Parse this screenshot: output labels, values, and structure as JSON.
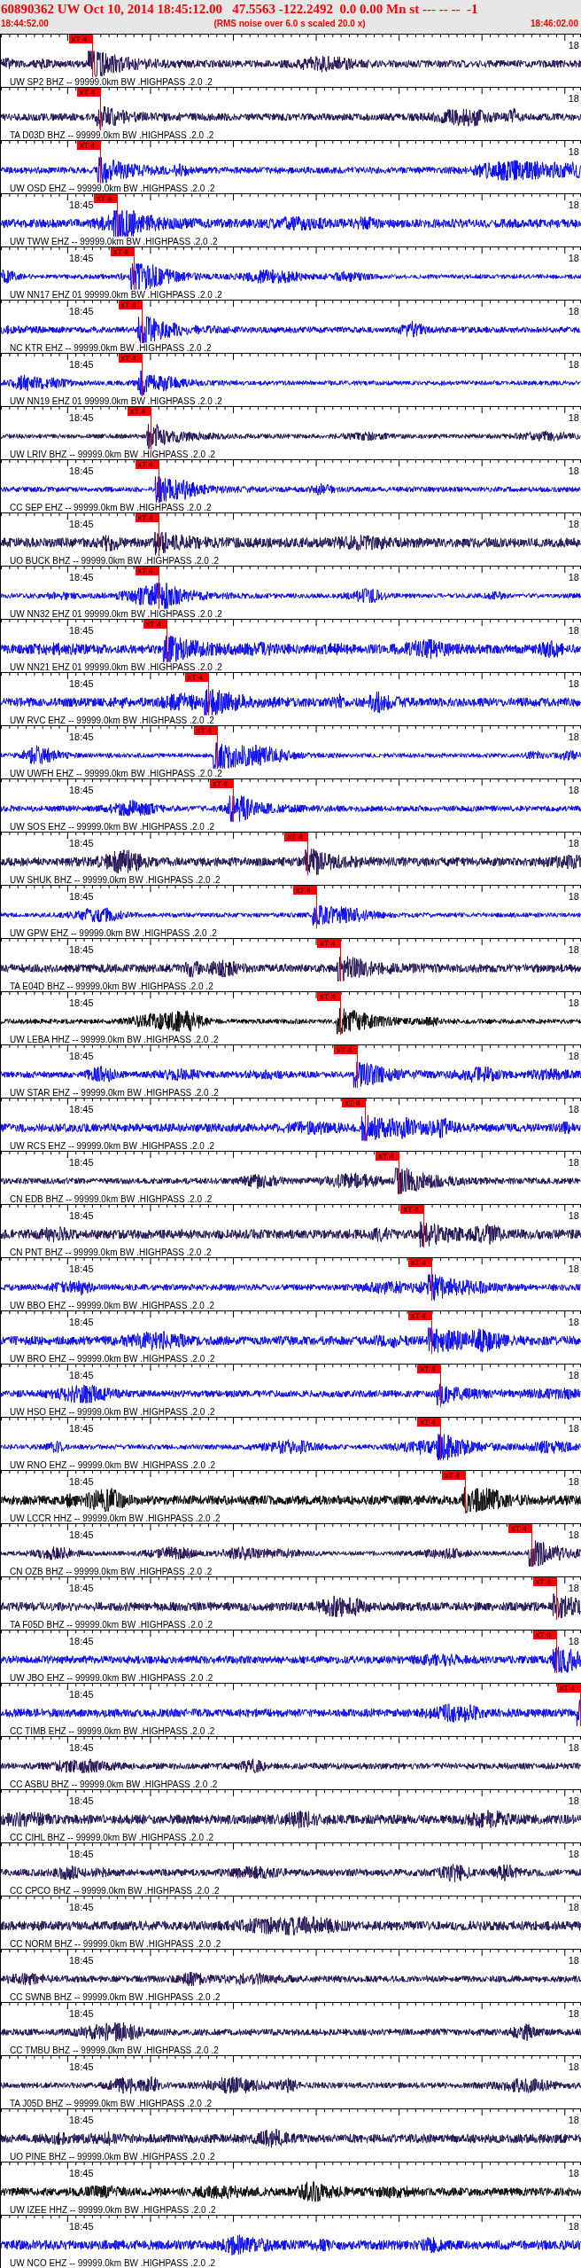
{
  "header": {
    "title": "60890362 UW Oct 10, 2014 18:45:12.00   47.5563 -122.2492  0.0 0.00 Mn st --- -- --  -1",
    "start_time": "18:44:52.00",
    "caption": "(RMS noise over 6.0 s scaled 20.0 x)",
    "end_time": "18:46:02.00"
  },
  "traces": [
    {
      "label": "UW SP2 BHZ -- 99999.0km BW .HIGHPASS .2.0 .2",
      "color": "#1e0a50",
      "end_label": "18",
      "pick": {
        "label": "xT 4",
        "level": 0.157
      }
    },
    {
      "label": "TA D03D BHZ -- 99999.0km BW .HIGHPASS .2.0 .2",
      "color": "#1e0a50",
      "end_label": "18",
      "pick": {
        "label": "xT 4",
        "level": 0.171
      }
    },
    {
      "label": "UW OSD EHZ -- 99999.0km BW .HIGHPASS .2.0 .2",
      "color": "#0000ff",
      "end_label": "18",
      "pick": {
        "label": "xT 4",
        "level": 0.171
      }
    },
    {
      "label": "UW TWW EHZ -- 99999.0km BW .HIGHPASS .2.0 .2",
      "color": "#0000ff",
      "time_label": "18:45",
      "end_label": "18",
      "pick": {
        "label": "xT 4",
        "level": 0.2
      }
    },
    {
      "label": "UW NN17 EHZ 01 99999.0km BW .HIGHPASS .2.0 .2",
      "color": "#0000ff",
      "time_label": "18:45",
      "end_label": "18",
      "pick": {
        "label": "xT 4",
        "level": 0.229
      }
    },
    {
      "label": "NC KTR EHZ -- 99999.0km BW .HIGHPASS .2.0 .2",
      "color": "#0000ff",
      "time_label": "18:45",
      "end_label": "18",
      "pick": {
        "label": "xT 4",
        "level": 0.242
      }
    },
    {
      "label": "UW NN19 EHZ 01 99999.0km BW .HIGHPASS .2.0 .2",
      "color": "#0000ff",
      "time_label": "18:45",
      "end_label": "18",
      "pick": {
        "label": "xT 4",
        "level": 0.242
      }
    },
    {
      "label": "UW LRIV BHZ -- 99999.0km BW .HIGHPASS .2.0 .2",
      "color": "#1e0a50",
      "time_label": "18:45",
      "end_label": "18",
      "pick": {
        "label": "xT 4",
        "level": 0.258
      }
    },
    {
      "label": "CC SEP EHZ -- 99999.0km BW .HIGHPASS .2.0 .2",
      "color": "#0000ff",
      "time_label": "18:45",
      "end_label": "18",
      "pick": {
        "label": "xT 4",
        "level": 0.271
      }
    },
    {
      "label": "UO BUCK BHZ -- 99999.0km BW .HIGHPASS .2.0 .2",
      "color": "#1e0a50",
      "time_label": "18:45",
      "end_label": "18",
      "pick": {
        "label": "xT 4",
        "level": 0.271
      }
    },
    {
      "label": "UW NN32 EHZ 01 99999.0km BW .HIGHPASS .2.0 .2",
      "color": "#0000ff",
      "time_label": "18:45",
      "end_label": "18",
      "pick": {
        "label": "xT 4",
        "level": 0.271
      }
    },
    {
      "label": "UW NN21 EHZ 01 99999.0km BW .HIGHPASS .2.0 .2",
      "color": "#0000ff",
      "time_label": "18:45",
      "end_label": "18",
      "pick": {
        "label": "xT 4",
        "level": 0.285
      }
    },
    {
      "label": "UW RVC EHZ -- 99999.0km BW .HIGHPASS .2.0 .2",
      "color": "#0000ff",
      "time_label": "18:45",
      "end_label": "18",
      "pick": {
        "label": "xT 4",
        "level": 0.357
      }
    },
    {
      "label": "UW UWFH EHZ -- 99999.0km BW .HIGHPASS .2.0 .2",
      "color": "#0000ff",
      "time_label": "18:45",
      "end_label": "18",
      "pick": {
        "label": "xT 4",
        "level": 0.372
      }
    },
    {
      "label": "UW SOS EHZ -- 99999.0km BW .HIGHPASS .2.0 .2",
      "color": "#0000ff",
      "time_label": "18:45",
      "end_label": "18",
      "pick": {
        "label": "xT 4",
        "level": 0.4
      }
    },
    {
      "label": "UW SHUK BHZ -- 99999.0km BW .HIGHPASS .2.0 .2",
      "color": "#1e0a50",
      "time_label": "18:45",
      "end_label": "18",
      "pick": {
        "label": "xT 4",
        "level": 0.529
      }
    },
    {
      "label": "UW GPW EHZ -- 99999.0km BW .HIGHPASS .2.0 .2",
      "color": "#0000ff",
      "time_label": "18:45",
      "end_label": "18",
      "pick": {
        "label": "xT 4",
        "level": 0.543
      }
    },
    {
      "label": "TA E04D BHZ -- 99999.0km BW .HIGHPASS .2.0 .2",
      "color": "#1e0a50",
      "time_label": "18:45",
      "end_label": "18",
      "pick": {
        "label": "xT 4",
        "level": 0.585
      }
    },
    {
      "label": "UW LEBA HHZ -- 99999.0km BW .HIGHPASS .2.0 .2",
      "color": "#000000",
      "time_label": "18:45",
      "end_label": "18",
      "pick": {
        "label": "xT 4",
        "level": 0.585
      }
    },
    {
      "label": "UW STAR EHZ -- 99999.0km BW .HIGHPASS .2.0 .2",
      "color": "#0000ff",
      "time_label": "18:45",
      "end_label": "18",
      "pick": {
        "label": "xT 4",
        "level": 0.614
      }
    },
    {
      "label": "UW RCS EHZ -- 99999.0km BW .HIGHPASS .2.0 .2",
      "color": "#0000ff",
      "time_label": "18:45",
      "end_label": "18",
      "pick": {
        "label": "xT 4",
        "level": 0.628
      }
    },
    {
      "label": "CN EDB BHZ -- 99999.0km BW .HIGHPASS .2.0 .2",
      "color": "#1e0a50",
      "time_label": "18:45",
      "end_label": "18",
      "pick": {
        "label": "xT 4",
        "level": 0.686
      }
    },
    {
      "label": "CN PNT BHZ -- 99999.0km BW .HIGHPASS .2.0 .2",
      "color": "#1e0a50",
      "time_label": "18:45",
      "end_label": "18",
      "pick": {
        "label": "xT 4",
        "level": 0.729
      }
    },
    {
      "label": "UW BBO EHZ -- 99999.0km BW .HIGHPASS .2.0 .2",
      "color": "#0000ff",
      "time_label": "18:45",
      "end_label": "18",
      "pick": {
        "label": "xT 4",
        "level": 0.742
      }
    },
    {
      "label": "UW BRO EHZ -- 99999.0km BW .HIGHPASS .2.0 .2",
      "color": "#0000ff",
      "time_label": "18:45",
      "end_label": "18",
      "pick": {
        "label": "xT 4",
        "level": 0.742
      }
    },
    {
      "label": "UW HSO EHZ -- 99999.0km BW .HIGHPASS .2.0 .2",
      "color": "#0000ff",
      "time_label": "18:45",
      "end_label": "18",
      "pick": {
        "label": "xT 4",
        "level": 0.758
      }
    },
    {
      "label": "UW RNO EHZ -- 99999.0km BW .HIGHPASS .2.0 .2",
      "color": "#0000ff",
      "time_label": "18:45",
      "end_label": "18",
      "pick": {
        "label": "xT 4",
        "level": 0.758
      }
    },
    {
      "label": "UW LCCR HHZ -- 99999.0km BW .HIGHPASS .2.0 .2",
      "color": "#000000",
      "time_label": "18:45",
      "end_label": "18",
      "pick": {
        "label": "xT 4",
        "level": 0.8
      }
    },
    {
      "label": "CN OZB BHZ -- 99999.0km BW .HIGHPASS .2.0 .2",
      "color": "#1e0a50",
      "time_label": "18:45",
      "end_label": "18",
      "pick": {
        "label": "xT 4",
        "level": 0.915
      }
    },
    {
      "label": "TA F05D BHZ -- 99999.0km BW .HIGHPASS .2.0 .2",
      "color": "#1e0a50",
      "time_label": "18:45",
      "end_label": "18",
      "pick": {
        "label": "xT 4",
        "level": 0.957
      }
    },
    {
      "label": "UW JBO EHZ -- 99999.0km BW .HIGHPASS .2.0 .2",
      "color": "#0000ff",
      "time_label": "18:45",
      "end_label": "18",
      "pick": {
        "label": "xT 4",
        "level": 0.957
      }
    },
    {
      "label": "CC TIMB EHZ -- 99999.0km BW .HIGHPASS .2.0 .2",
      "color": "#0000ff",
      "time_label": "18:45",
      "pick": {
        "label": "xT 4",
        "level": 1.0
      }
    },
    {
      "label": "CC ASBU BHZ -- 99999.0km BW .HIGHPASS .2.0 .2",
      "color": "#1e0a50",
      "time_label": "18:45",
      "end_label": "18"
    },
    {
      "label": "CC CIHL BHZ -- 99999.0km BW .HIGHPASS .2.0 .2",
      "color": "#1e0a50",
      "time_label": "18:45",
      "end_label": "18"
    },
    {
      "label": "CC CPCO BHZ -- 99999.0km BW .HIGHPASS .2.0 .2",
      "color": "#1e0a50",
      "time_label": "18:45",
      "end_label": "18"
    },
    {
      "label": "CC NORM BHZ -- 99999.0km BW .HIGHPASS .2.0 .2",
      "color": "#1e0a50",
      "time_label": "18:45",
      "end_label": "18"
    },
    {
      "label": "CC SWNB BHZ -- 99999.0km BW .HIGHPASS .2.0 .2",
      "color": "#1e0a50",
      "time_label": "18:45",
      "end_label": "18"
    },
    {
      "label": "CC TMBU BHZ -- 99999.0km BW .HIGHPASS .2.0 .2",
      "color": "#1e0a50",
      "time_label": "18:45",
      "end_label": "18"
    },
    {
      "label": "TA J05D BHZ -- 99999.0km BW .HIGHPASS .2.0 .2",
      "color": "#1e0a50",
      "time_label": "18:45",
      "end_label": "18"
    },
    {
      "label": "UO PINE BHZ -- 99999.0km BW .HIGHPASS .2.0 .2",
      "color": "#1e0a50",
      "time_label": "18:45",
      "end_label": "18"
    },
    {
      "label": "UW IZEE HHZ -- 99999.0km BW .HIGHPASS .2.0 .2",
      "color": "#000000",
      "time_label": "18:45",
      "end_label": "18"
    },
    {
      "label": "UW NCO EHZ -- 99999.0km BW .HIGHPASS .2.0 .2",
      "color": "#0000ff",
      "time_label": "18:45",
      "end_label": "18"
    }
  ]
}
